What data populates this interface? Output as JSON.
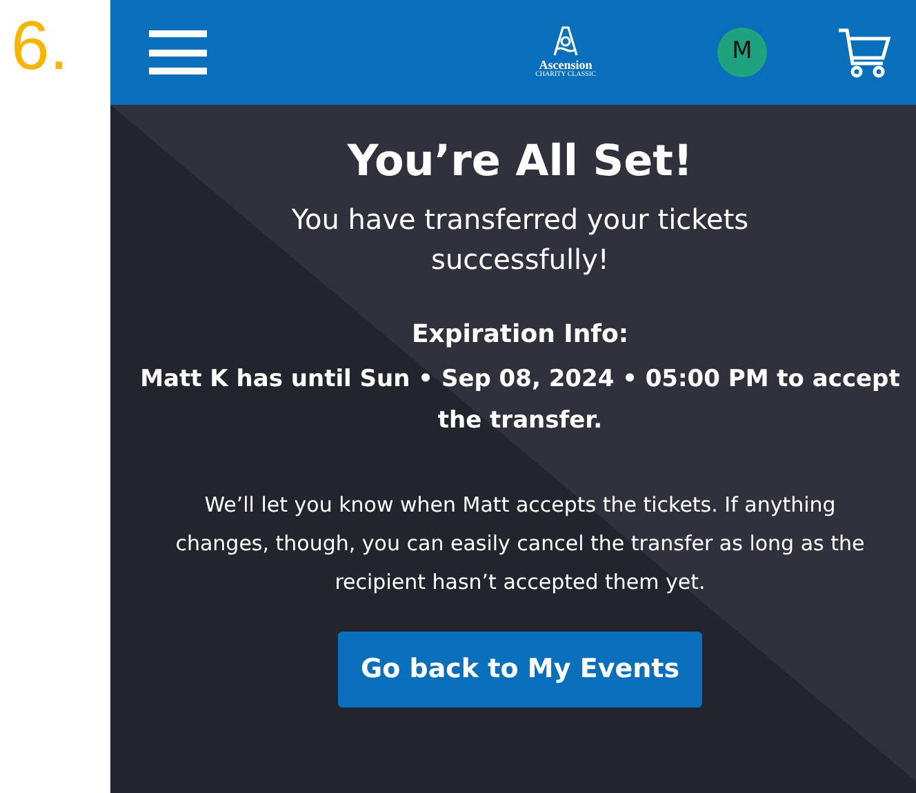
{
  "step_number": "6.",
  "header": {
    "logo": {
      "name": "Ascension",
      "subtitle": "CHARITY CLASSIC"
    },
    "avatar_initial": "M"
  },
  "confirmation": {
    "title": "You’re All Set!",
    "subtitle": "You have transferred your tickets successfully!",
    "expiration_heading": "Expiration Info:",
    "expiration_text": "Matt K has until Sun • Sep 08, 2024 • 05:00 PM to accept the transfer.",
    "note": "We’ll let you know when Matt accepts the tickets. If anything changes, though, you can easily cancel the transfer as long as the recipient hasn’t accepted them yet.",
    "button": "Go back to My Events"
  }
}
